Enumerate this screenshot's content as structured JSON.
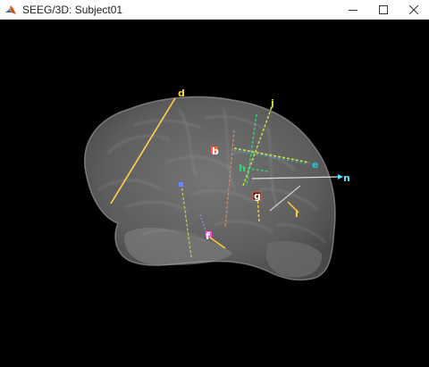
{
  "window": {
    "title": "SEEG/3D: Subject01",
    "controls": {
      "minimize": "minimize",
      "maximize": "maximize",
      "close": "close"
    }
  },
  "scene": {
    "background": "#000000",
    "brain_color": "#9a9a9a",
    "electrodes": [
      {
        "label": "d",
        "color": "#ffd24a"
      },
      {
        "label": "j",
        "color": "#c8e34a"
      },
      {
        "label": "b",
        "color": "#ff5a3c"
      },
      {
        "label": "h",
        "color": "#39d17a"
      },
      {
        "label": "e",
        "color": "#26c6da"
      },
      {
        "label": "n",
        "color": "#4fe3ff"
      },
      {
        "label": "g",
        "color": "#ff6a3c"
      },
      {
        "label": "i",
        "color": "#ffcf33"
      },
      {
        "label": "f",
        "color": "#ff4fd8"
      }
    ]
  }
}
